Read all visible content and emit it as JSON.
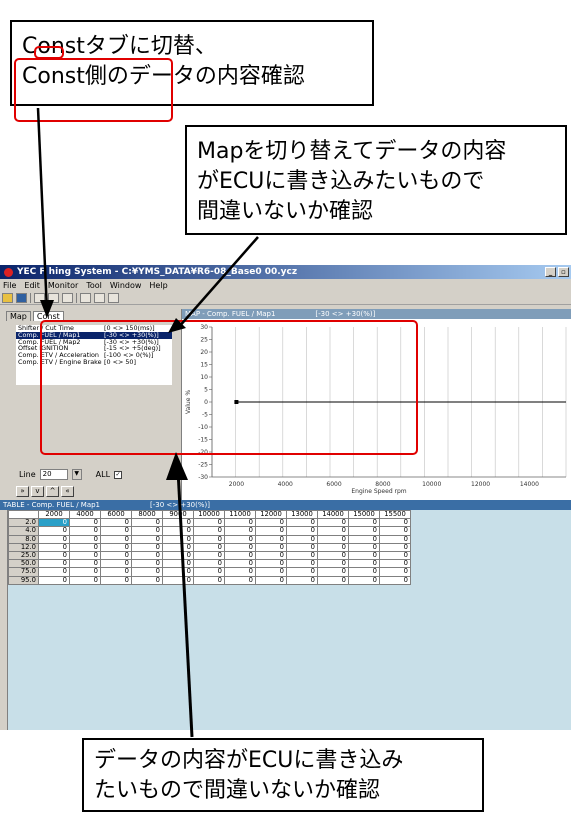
{
  "callouts": {
    "top_left": [
      "Constタブに切替、",
      "Const側のデータの内容確認"
    ],
    "top_right": [
      "Mapを切り替えてデータの内容",
      "がECUに書き込みたいもので",
      "間違いないか確認"
    ],
    "bottom": [
      "データの内容がECUに書き込み",
      "たいもので間違いないか確認"
    ]
  },
  "window": {
    "title": "YEC F    hing System - C:¥YMS_DATA¥R6-08_Base0     00.ycz",
    "menu": [
      "File",
      "Edit",
      "Monitor",
      "Tool",
      "Window",
      "Help"
    ]
  },
  "left_panel": {
    "tabs": [
      "Map",
      "Const"
    ],
    "params": [
      {
        "name": "Shifter / Cut Time",
        "range": "[0 <> 150(ms)]"
      },
      {
        "name": "Comp. FUEL / Map1",
        "range": "[-30 <> +30(%)]"
      },
      {
        "name": "Comp. FUEL / Map2",
        "range": "[-30 <> +30(%)]"
      },
      {
        "name": "Offset IGNITION",
        "range": "[-15 <> +5(deg)]"
      },
      {
        "name": "Comp. ETV / Acceleration",
        "range": "[-100 <> 0(%)]"
      },
      {
        "name": "Comp. ETV / Engine Brake",
        "range": "[0 <> 50]"
      }
    ],
    "selected_index": 1,
    "line_label": "Line",
    "line_value": "20",
    "all_label": "ALL",
    "all_checked": true
  },
  "map_panel": {
    "title": "MAP - Comp. FUEL / Map1",
    "range": "[-30 <> +30(%)]",
    "y_label": "Value %",
    "x_label": "Engine Speed rpm",
    "y_ticks": [
      "30",
      "25",
      "20",
      "15",
      "10",
      "5",
      "0",
      "-5",
      "-10",
      "-15",
      "-20",
      "-25",
      "-30"
    ],
    "x_ticks": [
      "2000",
      "4000",
      "6000",
      "8000",
      "10000",
      "12000",
      "14000"
    ]
  },
  "table_panel": {
    "title": "TABLE - Comp. FUEL / Map1",
    "range": "[-30 <> +30(%)]",
    "columns": [
      "2000",
      "4000",
      "6000",
      "8000",
      "9000",
      "10000",
      "11000",
      "12000",
      "13000",
      "14000",
      "15000",
      "15500"
    ],
    "rows": [
      {
        "label": "2.0",
        "values": [
          "0",
          "0",
          "0",
          "0",
          "0",
          "0",
          "0",
          "0",
          "0",
          "0",
          "0",
          "0"
        ]
      },
      {
        "label": "4.0",
        "values": [
          "0",
          "0",
          "0",
          "0",
          "0",
          "0",
          "0",
          "0",
          "0",
          "0",
          "0",
          "0"
        ]
      },
      {
        "label": "8.0",
        "values": [
          "0",
          "0",
          "0",
          "0",
          "0",
          "0",
          "0",
          "0",
          "0",
          "0",
          "0",
          "0"
        ]
      },
      {
        "label": "12.0",
        "values": [
          "0",
          "0",
          "0",
          "0",
          "0",
          "0",
          "0",
          "0",
          "0",
          "0",
          "0",
          "0"
        ]
      },
      {
        "label": "25.0",
        "values": [
          "0",
          "0",
          "0",
          "0",
          "0",
          "0",
          "0",
          "0",
          "0",
          "0",
          "0",
          "0"
        ]
      },
      {
        "label": "50.0",
        "values": [
          "0",
          "0",
          "0",
          "0",
          "0",
          "0",
          "0",
          "0",
          "0",
          "0",
          "0",
          "0"
        ]
      },
      {
        "label": "75.0",
        "values": [
          "0",
          "0",
          "0",
          "0",
          "0",
          "0",
          "0",
          "0",
          "0",
          "0",
          "0",
          "0"
        ]
      },
      {
        "label": "95.0",
        "values": [
          "0",
          "0",
          "0",
          "0",
          "0",
          "0",
          "0",
          "0",
          "0",
          "0",
          "0",
          "0"
        ]
      }
    ]
  },
  "colors": {
    "highlight": "#e00000",
    "title_blue": "#0a246a",
    "table_bg": "#c8dfe8"
  }
}
